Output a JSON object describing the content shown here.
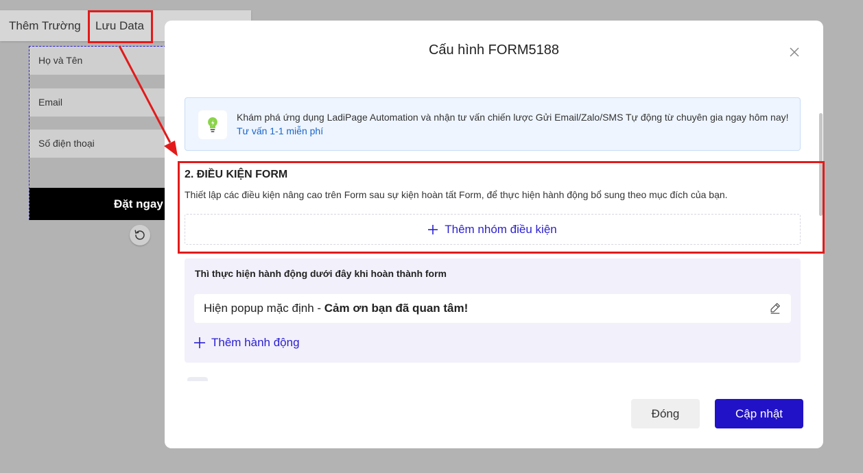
{
  "editor": {
    "toolbar": {
      "add_field": "Thêm Trường",
      "save_data": "Lưu Data"
    },
    "fields": [
      "Họ và Tên",
      "Email",
      "Số điện thoại"
    ],
    "submit_label": "Đặt ngay"
  },
  "modal": {
    "title": "Cấu hình FORM5188",
    "info": {
      "text": "Khám phá ứng dụng LadiPage Automation và nhận tư vấn chiến lược Gửi Email/Zalo/SMS Tự động từ chuyên gia ngay hôm nay!",
      "link": "Tư vấn 1-1 miễn phí"
    },
    "conditions": {
      "title": "2. ĐIỀU KIỆN FORM",
      "description": "Thiết lập các điều kiện nâng cao trên Form sau sự kiện hoàn tất Form, để thực hiện hành động bổ sung theo mục đích của bạn.",
      "add_group": "Thêm nhóm điều kiện"
    },
    "actions": {
      "heading": "Thì thực hiện hành động dưới đây khi hoàn thành form",
      "item_prefix": "Hiện popup mặc định - ",
      "item_value": "Cảm ơn bạn đã quan tâm!",
      "add_action": "Thêm hành động"
    },
    "buttons": {
      "close": "Đóng",
      "update": "Cập nhật"
    }
  },
  "colors": {
    "accent": "#2112c7",
    "annotation": "#e31a1a",
    "info_bg": "#eef5fe"
  }
}
